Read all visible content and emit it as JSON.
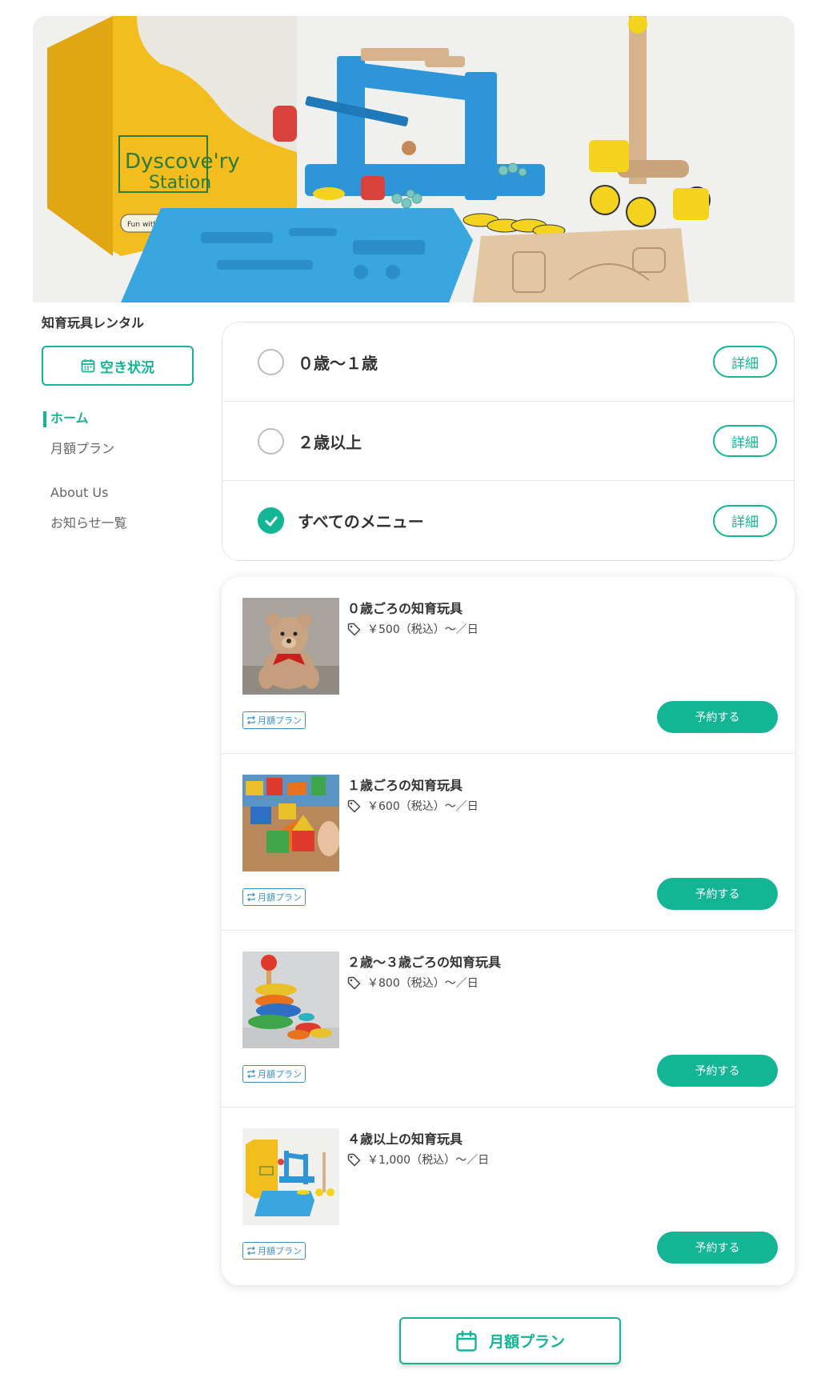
{
  "hero": {
    "box_lines": [
      "Dyscove'ry",
      "Station"
    ],
    "box_tagline": "Fun with Gravity (Gravity car/Marble Run)"
  },
  "sidebar": {
    "shop_name": "知育玩具レンタル",
    "availability_button": "空き状況",
    "nav": [
      {
        "label": "ホーム",
        "active": true
      },
      {
        "label": "月額プラン",
        "active": false
      },
      {
        "label": "About Us",
        "active": false
      },
      {
        "label": "お知らせ一覧",
        "active": false
      }
    ]
  },
  "filters": [
    {
      "label": "０歳〜１歳",
      "checked": false,
      "detail_label": "詳細"
    },
    {
      "label": "２歳以上",
      "checked": false,
      "detail_label": "詳細"
    },
    {
      "label": "すべてのメニュー",
      "checked": true,
      "detail_label": "詳細"
    }
  ],
  "products": [
    {
      "name": "０歳ごろの知育玩具",
      "price": "￥500（税込）〜／日",
      "badge": "月額プラン",
      "button": "予約する",
      "image": "teddy-bear"
    },
    {
      "name": "１歳ごろの知育玩具",
      "price": "￥600（税込）〜／日",
      "badge": "月額プラン",
      "button": "予約する",
      "image": "wooden-blocks"
    },
    {
      "name": "２歳〜３歳ごろの知育玩具",
      "price": "￥800（税込）〜／日",
      "badge": "月額プラン",
      "button": "予約する",
      "image": "stacking-rings"
    },
    {
      "name": "４歳以上の知育玩具",
      "price": "￥1,000（税込）〜／日",
      "badge": "月額プラン",
      "button": "予約する",
      "image": "discovery-station-kit"
    }
  ],
  "bottom_button": {
    "label": "月額プラン"
  },
  "colors": {
    "accent": "#13b594",
    "badge": "#3a8fc9",
    "text": "#333333"
  }
}
